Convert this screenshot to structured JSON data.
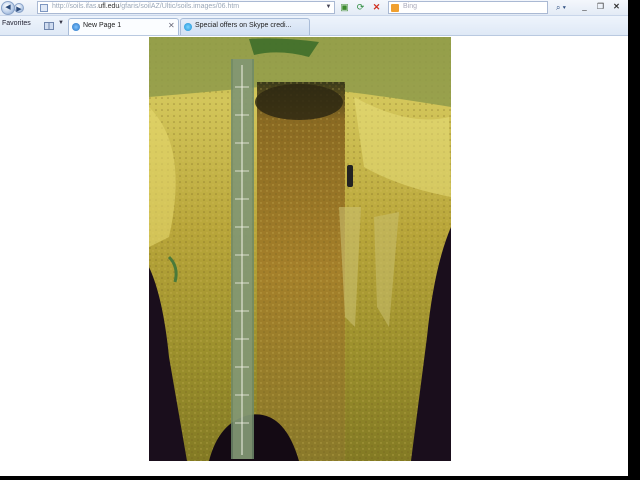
{
  "browser": {
    "address": {
      "prefix": "http://soils.ifas.",
      "domain": "ufl.edu",
      "suffix": "/gfaris/soilAZ/Ultic/soils.images/06.htm"
    },
    "search_placeholder": "Bing",
    "favorites_label": "Favorites",
    "tabs": [
      {
        "label": "New Page 1"
      },
      {
        "label": "Special offers on Skype credi..."
      }
    ]
  },
  "icons": {
    "back": "back-arrow-icon",
    "forward": "forward-arrow-icon",
    "refresh": "refresh-icon",
    "stop": "stop-icon",
    "search": "search-icon",
    "favorites": "favorites-star-icon"
  },
  "colors": {
    "chrome_bg": "#eef3fb",
    "page_bg": "#ffffff",
    "soil_upper": "#c9b94a",
    "soil_lower": "#8f8a2a"
  }
}
